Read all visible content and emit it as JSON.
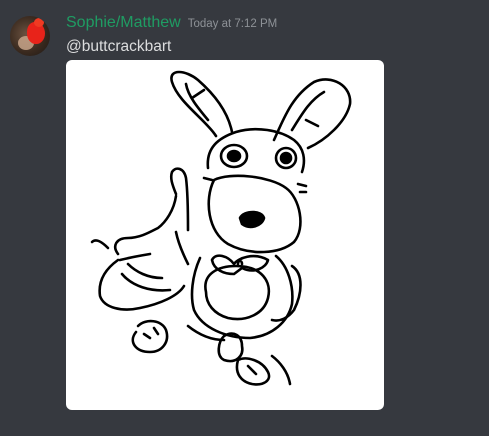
{
  "message": {
    "username": "Sophie/Matthew",
    "timestamp": "Today at 7:12 PM",
    "text": "@buttcrackbart",
    "username_color": "#1f9c63"
  },
  "theme": {
    "background": "#36393f",
    "text": "#dcddde",
    "muted": "#8e9297"
  }
}
